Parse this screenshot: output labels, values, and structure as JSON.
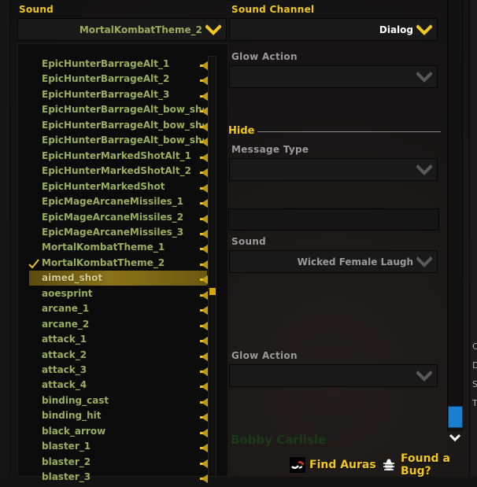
{
  "sound": {
    "label": "Sound",
    "selected": "MortalKombatTheme_2",
    "options": [
      {
        "label": "EpicHunterBarrageAlt_1"
      },
      {
        "label": "EpicHunterBarrageAlt_2"
      },
      {
        "label": "EpicHunterBarrageAlt_3"
      },
      {
        "label": "EpicHunterBarrageAlt_bow_shoot..."
      },
      {
        "label": "EpicHunterBarrageAlt_bow_shoot..."
      },
      {
        "label": "EpicHunterBarrageAlt_bow_shoot..."
      },
      {
        "label": "EpicHunterMarkedShotAlt_1"
      },
      {
        "label": "EpicHunterMarkedShotAlt_2"
      },
      {
        "label": "EpicHunterMarkedShot"
      },
      {
        "label": "EpicMageArcaneMissiles_1"
      },
      {
        "label": "EpicMageArcaneMissiles_2"
      },
      {
        "label": "EpicMageArcaneMissiles_3"
      },
      {
        "label": "MortalKombatTheme_1"
      },
      {
        "label": "MortalKombatTheme_2",
        "checked": true
      },
      {
        "label": "aimed_shot",
        "highlighted": true
      },
      {
        "label": "aoesprint"
      },
      {
        "label": "arcane_1"
      },
      {
        "label": "arcane_2"
      },
      {
        "label": "attack_1"
      },
      {
        "label": "attack_2"
      },
      {
        "label": "attack_3"
      },
      {
        "label": "attack_4"
      },
      {
        "label": "binding_cast"
      },
      {
        "label": "binding_hit"
      },
      {
        "label": "black_arrow"
      },
      {
        "label": "blaster_1"
      },
      {
        "label": "blaster_2"
      },
      {
        "label": "blaster_3"
      }
    ],
    "list_scroll_position": 0.55
  },
  "sound_channel": {
    "label": "Sound Channel",
    "value": "Dialog"
  },
  "glow_action_1": {
    "label": "Glow Action",
    "value": ""
  },
  "hide_section": {
    "title": "Hide"
  },
  "message_type": {
    "label": "Message Type",
    "value": ""
  },
  "message_text": {
    "value": ""
  },
  "hide_sound": {
    "label": "Sound",
    "value": "Wicked Female Laugh"
  },
  "glow_action_2": {
    "label": "Glow Action",
    "value": ""
  },
  "background_name": "Bobby Carlisle",
  "side_letters": [
    "C",
    "D",
    "S",
    "T"
  ],
  "footer": {
    "find_auras": "Find Auras",
    "found_bug": "Found a Bug?"
  },
  "colors": {
    "accent_gold": "#f0c81a",
    "option_text": "#9cac5c",
    "scroll_thumb_blue": "#1a7fd0"
  }
}
